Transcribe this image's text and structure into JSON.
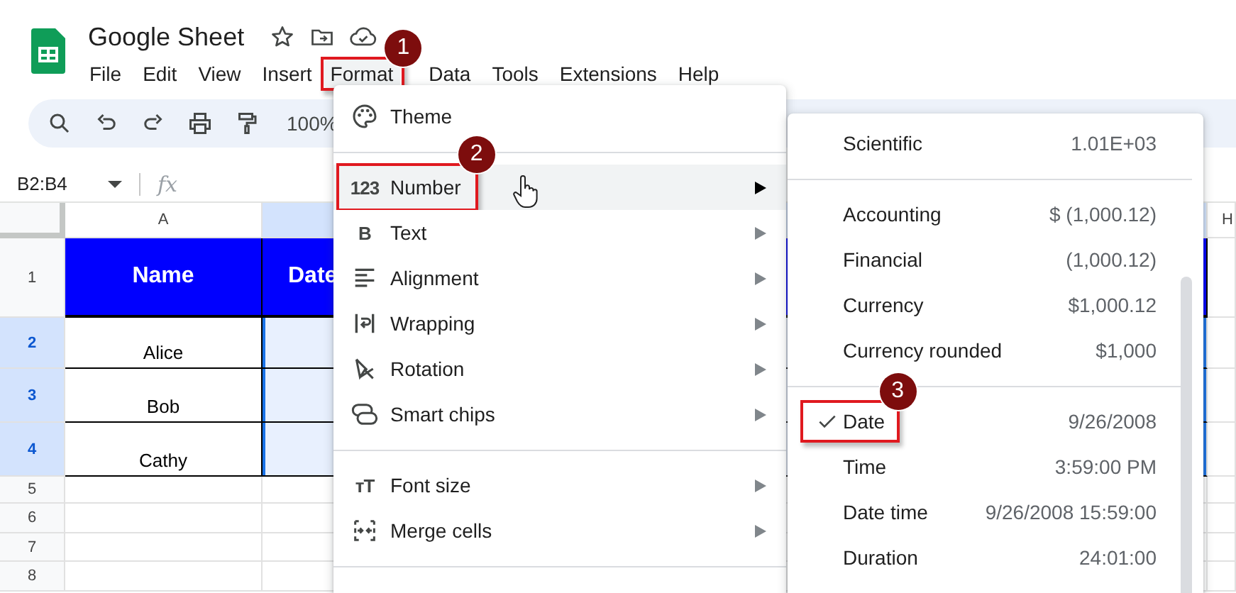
{
  "app": {
    "title": "Google Sheet"
  },
  "menubar": [
    {
      "label": "File",
      "selected": false
    },
    {
      "label": "Edit",
      "selected": false
    },
    {
      "label": "View",
      "selected": false
    },
    {
      "label": "Insert",
      "selected": false
    },
    {
      "label": "Format",
      "selected": true,
      "step": "1"
    },
    {
      "label": "Data",
      "selected": false
    },
    {
      "label": "Tools",
      "selected": false
    },
    {
      "label": "Extensions",
      "selected": false
    },
    {
      "label": "Help",
      "selected": false
    }
  ],
  "toolbar": {
    "zoom": "100%"
  },
  "formula_bar": {
    "name_box": "B2:B4",
    "function_label": "fx"
  },
  "grid": {
    "columns": [
      {
        "label": "A",
        "selected": false
      },
      {
        "selected": true
      },
      {
        "label": "H",
        "selected": false
      }
    ],
    "rows": [
      {
        "number": "1",
        "selected": false,
        "cells": [
          {
            "text": "Name",
            "kind": "header",
            "selected": false
          },
          {
            "text": "Date",
            "kind": "header",
            "selected": false
          }
        ]
      },
      {
        "number": "2",
        "selected": true,
        "cells": [
          {
            "text": "Alice",
            "kind": "plain",
            "selected": false
          },
          {
            "kind": "plain",
            "selected": true
          }
        ]
      },
      {
        "number": "3",
        "selected": true,
        "cells": [
          {
            "text": "Bob",
            "kind": "plain",
            "selected": false
          },
          {
            "kind": "plain",
            "selected": true
          }
        ]
      },
      {
        "number": "4",
        "selected": true,
        "cells": [
          {
            "text": "Cathy",
            "kind": "plain",
            "selected": false
          },
          {
            "kind": "plain",
            "selected": true
          }
        ]
      },
      {
        "number": "5",
        "selected": false
      },
      {
        "number": "6",
        "selected": false
      },
      {
        "number": "7",
        "selected": false
      },
      {
        "number": "8",
        "selected": false
      }
    ]
  },
  "format_menu": {
    "sections": [
      [
        {
          "label": "Theme",
          "submenu": false,
          "highlighted": false
        }
      ],
      [
        {
          "label": "Number",
          "glyph": "123",
          "submenu": true,
          "highlighted": true,
          "step": "2"
        },
        {
          "label": "Text",
          "glyph": "B",
          "submenu": true,
          "highlighted": false
        },
        {
          "label": "Alignment",
          "submenu": true,
          "highlighted": false
        },
        {
          "label": "Wrapping",
          "submenu": true,
          "highlighted": false
        },
        {
          "label": "Rotation",
          "submenu": true,
          "highlighted": false
        },
        {
          "label": "Smart chips",
          "submenu": true,
          "highlighted": false
        }
      ],
      [
        {
          "label": "Font size",
          "glyph": "ᴛT",
          "submenu": true,
          "highlighted": false
        },
        {
          "label": "Merge cells",
          "submenu": true,
          "highlighted": false
        }
      ]
    ]
  },
  "number_submenu": {
    "sections": [
      [
        {
          "label": "Scientific",
          "value": "1.01E+03",
          "checked": false
        }
      ],
      [
        {
          "label": "Accounting",
          "value": "$ (1,000.12)",
          "checked": false
        },
        {
          "label": "Financial",
          "value": "(1,000.12)",
          "checked": false
        },
        {
          "label": "Currency",
          "value": "$1,000.12",
          "checked": false
        },
        {
          "label": "Currency rounded",
          "value": "$1,000",
          "checked": false
        }
      ],
      [
        {
          "label": "Date",
          "value": "9/26/2008",
          "checked": true,
          "step": "3"
        },
        {
          "label": "Time",
          "value": "3:59:00 PM",
          "checked": false
        },
        {
          "label": "Date time",
          "value": "9/26/2008 15:59:00",
          "checked": false
        },
        {
          "label": "Duration",
          "value": "24:01:00",
          "checked": false
        }
      ]
    ]
  }
}
